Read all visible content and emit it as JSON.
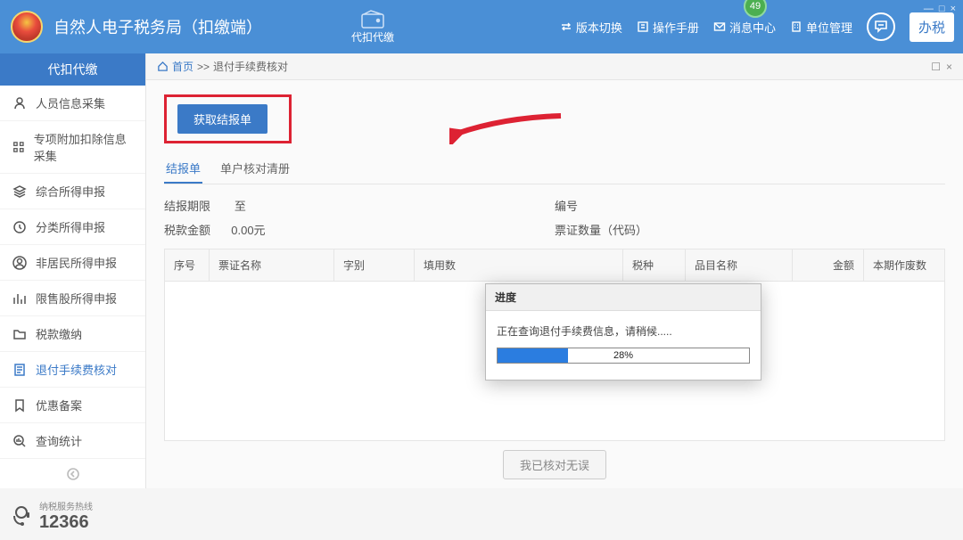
{
  "header": {
    "app_title": "自然人电子税务局（扣缴端）",
    "center_label": "代扣代缴",
    "badge_number": "49",
    "actions": {
      "version": "版本切换",
      "manual": "操作手册",
      "messages": "消息中心",
      "units": "单位管理",
      "handle": "办税"
    },
    "win": {
      "min": "—",
      "max": "□",
      "close": "×"
    }
  },
  "sidebar": {
    "header": "代扣代缴",
    "items": [
      {
        "label": "人员信息采集"
      },
      {
        "label": "专项附加扣除信息采集"
      },
      {
        "label": "综合所得申报"
      },
      {
        "label": "分类所得申报"
      },
      {
        "label": "非居民所得申报"
      },
      {
        "label": "限售股所得申报"
      },
      {
        "label": "税款缴纳"
      },
      {
        "label": "退付手续费核对",
        "active": true
      },
      {
        "label": "优惠备案"
      },
      {
        "label": "查询统计"
      }
    ],
    "hotline": {
      "label": "纳税服务热线",
      "number": "12366"
    }
  },
  "breadcrumb": {
    "home": "首页",
    "sep": ">>",
    "current": "退付手续费核对",
    "collapse": "☐",
    "close": "×"
  },
  "content": {
    "fetch_button": "获取结报单",
    "tabs": {
      "t1": "结报单",
      "t2": "单户核对清册"
    },
    "details": {
      "period_label": "结报期限",
      "period_to": "至",
      "serial_label": "编号",
      "amount_label": "税款金额",
      "amount_value": "0.00元",
      "voucher_label": "票证数量（代码）"
    },
    "columns": {
      "c1": "序号",
      "c2": "票证名称",
      "c3": "字别",
      "c4": "填用数",
      "c5": "税种",
      "c6": "品目名称",
      "c7": "金额",
      "c8": "本期作废数"
    },
    "footer_button": "我已核对无误"
  },
  "modal": {
    "title": "进度",
    "message": "正在查询退付手续费信息，请稍候.....",
    "percent_text": "28%",
    "percent_value": 28
  }
}
